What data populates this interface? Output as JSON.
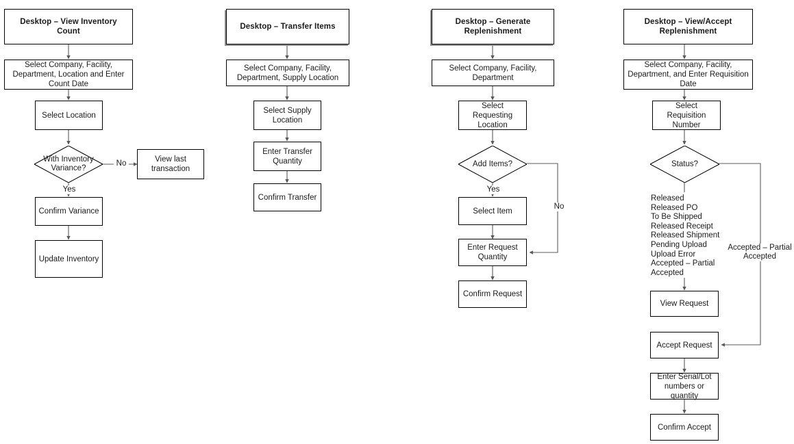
{
  "diagram": {
    "title": "Desktop Inventory Process Flowcharts",
    "line_color": "#595959",
    "box_border_color": "#000000",
    "text_color": "#1a1a1a",
    "shadow_color": "#8d8d8d",
    "background": "#ffffff"
  },
  "flows": [
    {
      "id": "view-inventory-count",
      "header": "Desktop – View Inventory Count",
      "nodes": [
        {
          "id": "c1-n1",
          "label": "Select Company, Facility, Department, Location and Enter Count Date"
        },
        {
          "id": "c1-n2",
          "label": "Select Location"
        },
        {
          "id": "c1-d1",
          "label": "With Inventory Variance?",
          "shape": "diamond"
        },
        {
          "id": "c1-n3",
          "label": "View last transaction"
        },
        {
          "id": "c1-n4",
          "label": "Confirm Variance"
        },
        {
          "id": "c1-n5",
          "label": "Update Inventory"
        }
      ],
      "edge_labels": [
        "No",
        "Yes"
      ]
    },
    {
      "id": "transfer-items",
      "header": "Desktop – Transfer Items",
      "nodes": [
        {
          "id": "c2-n1",
          "label": "Select Company, Facility, Department, Supply Location"
        },
        {
          "id": "c2-n2",
          "label": "Select Supply Location"
        },
        {
          "id": "c2-n3",
          "label": "Enter Transfer Quantity"
        },
        {
          "id": "c2-n4",
          "label": "Confirm Transfer"
        }
      ],
      "edge_labels": []
    },
    {
      "id": "generate-replenishment",
      "header": "Desktop – Generate Replenishment",
      "nodes": [
        {
          "id": "c3-n1",
          "label": "Select Company, Facility, Department"
        },
        {
          "id": "c3-n2",
          "label": "Select Requesting Location"
        },
        {
          "id": "c3-d1",
          "label": "Add Items?",
          "shape": "diamond"
        },
        {
          "id": "c3-n3",
          "label": "Select  Item"
        },
        {
          "id": "c3-n4",
          "label": "Enter Request Quantity"
        },
        {
          "id": "c3-n5",
          "label": "Confirm Request"
        }
      ],
      "edge_labels": [
        "Yes",
        "No"
      ]
    },
    {
      "id": "view-accept-replenishment",
      "header": "Desktop – View/Accept Replenishment",
      "nodes": [
        {
          "id": "c4-n1",
          "label": "Select Company, Facility, Department, and Enter Requisition Date"
        },
        {
          "id": "c4-n2",
          "label": "Select Requisition Number"
        },
        {
          "id": "c4-d1",
          "label": "Status?",
          "shape": "diamond"
        },
        {
          "id": "c4-n3",
          "label": "View Request"
        },
        {
          "id": "c4-n4",
          "label": "Accept Request"
        },
        {
          "id": "c4-n5",
          "label": "Enter Serial/Lot numbers or quantity"
        },
        {
          "id": "c4-n6",
          "label": "Confirm Accept"
        }
      ],
      "status_list": "Released\nReleased PO\nTo Be Shipped\nReleased Receipt\nReleased Shipment\nPending Upload\nUpload Error\nAccepted – Partial\nAccepted",
      "edge_labels": [
        "Accepted – Partial\nAccepted"
      ]
    }
  ],
  "labels": {
    "c1_no": "No",
    "c1_yes": "Yes",
    "c3_yes": "Yes",
    "c3_no": "No",
    "c4_accepted": "Accepted – Partial\nAccepted",
    "c4_status_list": "Released\nReleased PO\nTo Be Shipped\nReleased Receipt\nReleased Shipment\nPending Upload\nUpload Error\nAccepted – Partial\nAccepted"
  }
}
